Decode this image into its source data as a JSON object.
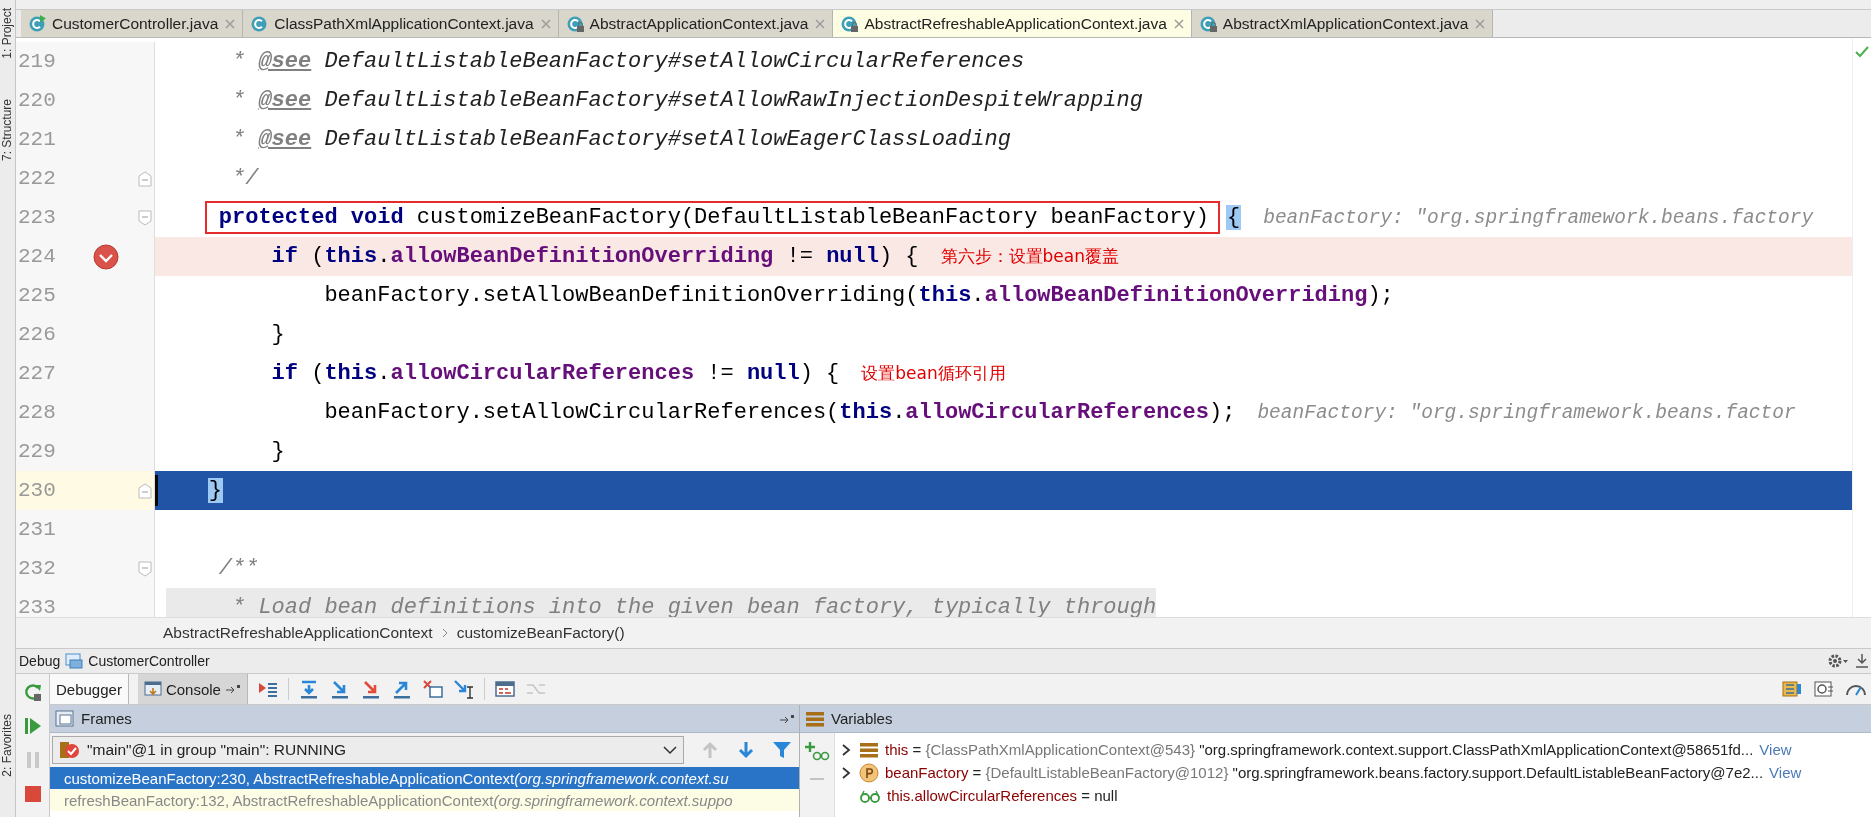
{
  "tool_strip": {
    "labels": [
      {
        "text": "1: Project"
      },
      {
        "text": "7: Structure"
      },
      {
        "text": "2: Favorites"
      }
    ]
  },
  "tabs": [
    {
      "label": "CustomerController.java",
      "kind": "run",
      "selected": false
    },
    {
      "label": "ClassPathXmlApplicationContext.java",
      "kind": "class",
      "selected": false
    },
    {
      "label": "AbstractApplicationContext.java",
      "kind": "locked",
      "selected": false
    },
    {
      "label": "AbstractRefreshableApplicationContext.java",
      "kind": "locked",
      "selected": true
    },
    {
      "label": "AbstractXmlApplicationContext.java",
      "kind": "locked",
      "selected": false
    }
  ],
  "editor": {
    "lines": [
      {
        "number": "219",
        "kind": "doc",
        "breakpoint": false,
        "current": false,
        "shaded": false,
        "fold_open": false,
        "fold_close": false,
        "segments": [
          {
            "kind": "code",
            "tokens": [
              {
                "kind": "comment",
                "text": "* "
              },
              {
                "kind": "doctag",
                "text": "@see"
              },
              {
                "kind": "docref",
                "text": " DefaultListableBeanFactory#setAllowCircularReferences"
              }
            ]
          }
        ]
      },
      {
        "number": "220",
        "kind": "doc",
        "breakpoint": false,
        "current": false,
        "shaded": false,
        "fold_open": false,
        "fold_close": false,
        "segments": [
          {
            "kind": "code",
            "tokens": [
              {
                "kind": "comment",
                "text": "* "
              },
              {
                "kind": "doctag",
                "text": "@see"
              },
              {
                "kind": "docref",
                "text": " DefaultListableBeanFactory#setAllowRawInjectionDespiteWrapping"
              }
            ]
          }
        ]
      },
      {
        "number": "221",
        "kind": "doc",
        "breakpoint": false,
        "current": false,
        "shaded": false,
        "fold_open": false,
        "fold_close": false,
        "segments": [
          {
            "kind": "code",
            "tokens": [
              {
                "kind": "comment",
                "text": "* "
              },
              {
                "kind": "doctag",
                "text": "@see"
              },
              {
                "kind": "docref",
                "text": " DefaultListableBeanFactory#setAllowEagerClassLoading"
              }
            ]
          }
        ]
      },
      {
        "number": "222",
        "kind": "doc",
        "breakpoint": false,
        "current": false,
        "shaded": false,
        "fold_open": false,
        "fold_close": true,
        "segments": [
          {
            "kind": "code",
            "tokens": [
              {
                "kind": "comment",
                "text": "*/"
              }
            ]
          }
        ]
      },
      {
        "number": "223",
        "kind": "member",
        "breakpoint": false,
        "current": false,
        "shaded": false,
        "fold_open": true,
        "fold_close": false,
        "segments": [
          {
            "kind": "box",
            "segments": [
              {
                "kind": "code",
                "tokens": [
                  {
                    "kind": "kw",
                    "text": "protected void"
                  },
                  {
                    "kind": "plain",
                    "text": " customizeBeanFactory(DefaultListableBeanFactory beanFactory)"
                  }
                ]
              }
            ]
          },
          {
            "kind": "brace",
            "text": "{"
          },
          {
            "kind": "hint",
            "text": "beanFactory: \"org.springframework.beans.factory"
          }
        ]
      },
      {
        "number": "224",
        "kind": "statement",
        "breakpoint": true,
        "current": false,
        "shaded": false,
        "fold_open": false,
        "fold_close": false,
        "segments": [
          {
            "kind": "code",
            "tokens": [
              {
                "kind": "kw",
                "text": "if"
              },
              {
                "kind": "plain",
                "text": " ("
              },
              {
                "kind": "kw",
                "text": "this"
              },
              {
                "kind": "plain",
                "text": "."
              },
              {
                "kind": "field",
                "text": "allowBeanDefinitionOverriding"
              },
              {
                "kind": "plain",
                "text": " != "
              },
              {
                "kind": "kw",
                "text": "null"
              },
              {
                "kind": "plain",
                "text": ") {"
              }
            ]
          },
          {
            "kind": "note",
            "text": "第六步：设置bean覆盖"
          }
        ]
      },
      {
        "number": "225",
        "kind": "nested",
        "breakpoint": false,
        "current": false,
        "shaded": false,
        "fold_open": false,
        "fold_close": false,
        "segments": [
          {
            "kind": "code",
            "tokens": [
              {
                "kind": "plain",
                "text": "beanFactory.setAllowBeanDefinitionOverriding("
              },
              {
                "kind": "kw",
                "text": "this"
              },
              {
                "kind": "plain",
                "text": "."
              },
              {
                "kind": "field",
                "text": "allowBeanDefinitionOverriding"
              },
              {
                "kind": "plain",
                "text": ");"
              }
            ]
          }
        ]
      },
      {
        "number": "226",
        "kind": "statement",
        "breakpoint": false,
        "current": false,
        "shaded": false,
        "fold_open": false,
        "fold_close": false,
        "segments": [
          {
            "kind": "code",
            "tokens": [
              {
                "kind": "plain",
                "text": "}"
              }
            ]
          }
        ]
      },
      {
        "number": "227",
        "kind": "statement",
        "breakpoint": false,
        "current": false,
        "shaded": false,
        "fold_open": false,
        "fold_close": false,
        "segments": [
          {
            "kind": "code",
            "tokens": [
              {
                "kind": "kw",
                "text": "if"
              },
              {
                "kind": "plain",
                "text": " ("
              },
              {
                "kind": "kw",
                "text": "this"
              },
              {
                "kind": "plain",
                "text": "."
              },
              {
                "kind": "field",
                "text": "allowCircularReferences"
              },
              {
                "kind": "plain",
                "text": " != "
              },
              {
                "kind": "kw",
                "text": "null"
              },
              {
                "kind": "plain",
                "text": ") {"
              }
            ]
          },
          {
            "kind": "note",
            "text": "设置bean循环引用"
          }
        ]
      },
      {
        "number": "228",
        "kind": "nested",
        "breakpoint": false,
        "current": false,
        "shaded": false,
        "fold_open": false,
        "fold_close": false,
        "segments": [
          {
            "kind": "code",
            "tokens": [
              {
                "kind": "plain",
                "text": "beanFactory.setAllowCircularReferences("
              },
              {
                "kind": "kw",
                "text": "this"
              },
              {
                "kind": "plain",
                "text": "."
              },
              {
                "kind": "field",
                "text": "allowCircularReferences"
              },
              {
                "kind": "plain",
                "text": ");"
              }
            ]
          },
          {
            "kind": "hint",
            "text": "beanFactory: \"org.springframework.beans.factor"
          }
        ]
      },
      {
        "number": "229",
        "kind": "statement",
        "breakpoint": false,
        "current": false,
        "shaded": false,
        "fold_open": false,
        "fold_close": false,
        "segments": [
          {
            "kind": "code",
            "tokens": [
              {
                "kind": "plain",
                "text": "}"
              }
            ]
          }
        ]
      },
      {
        "number": "230",
        "kind": "member",
        "breakpoint": false,
        "current": true,
        "shaded": false,
        "fold_open": false,
        "fold_close": true,
        "segments": [
          {
            "kind": "brace",
            "text": "}"
          }
        ]
      },
      {
        "number": "231",
        "kind": "blank",
        "breakpoint": false,
        "current": false,
        "shaded": false,
        "fold_open": false,
        "fold_close": false
      },
      {
        "number": "232",
        "kind": "member",
        "breakpoint": false,
        "current": false,
        "shaded": false,
        "fold_open": true,
        "fold_close": false,
        "segments": [
          {
            "kind": "code",
            "tokens": [
              {
                "kind": "comment",
                "text": "/**"
              }
            ]
          }
        ]
      },
      {
        "number": "233",
        "kind": "doc",
        "breakpoint": false,
        "current": false,
        "shaded": true,
        "fold_open": false,
        "fold_close": false,
        "segments": [
          {
            "kind": "code",
            "tokens": [
              {
                "kind": "comment",
                "text": "* Load bean definitions into the given bean factory, typically through"
              }
            ]
          }
        ]
      }
    ]
  },
  "breadcrumbs": [
    "AbstractRefreshableApplicationContext",
    "customizeBeanFactory()"
  ],
  "debug": {
    "title": "Debug",
    "config": "CustomerController",
    "tabs": [
      {
        "label": "Debugger",
        "selected": true
      },
      {
        "label": "Console",
        "selected": false
      }
    ],
    "frames": {
      "title": "Frames",
      "thread": "\"main\"@1 in group \"main\": RUNNING",
      "items": [
        {
          "method": "customizeBeanFactory:230, AbstractRefreshableApplicationContext",
          "package": "(org.springframework.context.su",
          "selected": true
        },
        {
          "method": "refreshBeanFactory:132, AbstractRefreshableApplicationContext",
          "package": "(org.springframework.context.suppo",
          "selected": false
        }
      ]
    },
    "variables": {
      "title": "Variables",
      "items": [
        {
          "kind": "field",
          "expandable": true,
          "name": "this",
          "sign": "=",
          "type": "{ClassPathXmlApplicationContext@543}",
          "value": "\"org.springframework.context.support.ClassPathXmlApplicationContext@58651fd...",
          "link": "View"
        },
        {
          "kind": "param",
          "expandable": true,
          "name": "beanFactory",
          "sign": "=",
          "type": "{DefaultListableBeanFactory@1012}",
          "value": "\"org.springframework.beans.factory.support.DefaultListableBeanFactory@7e2...",
          "link": "View"
        },
        {
          "kind": "watch",
          "expandable": false,
          "name": "this.allowCircularReferences",
          "sign": "=",
          "value": "null"
        }
      ]
    }
  }
}
